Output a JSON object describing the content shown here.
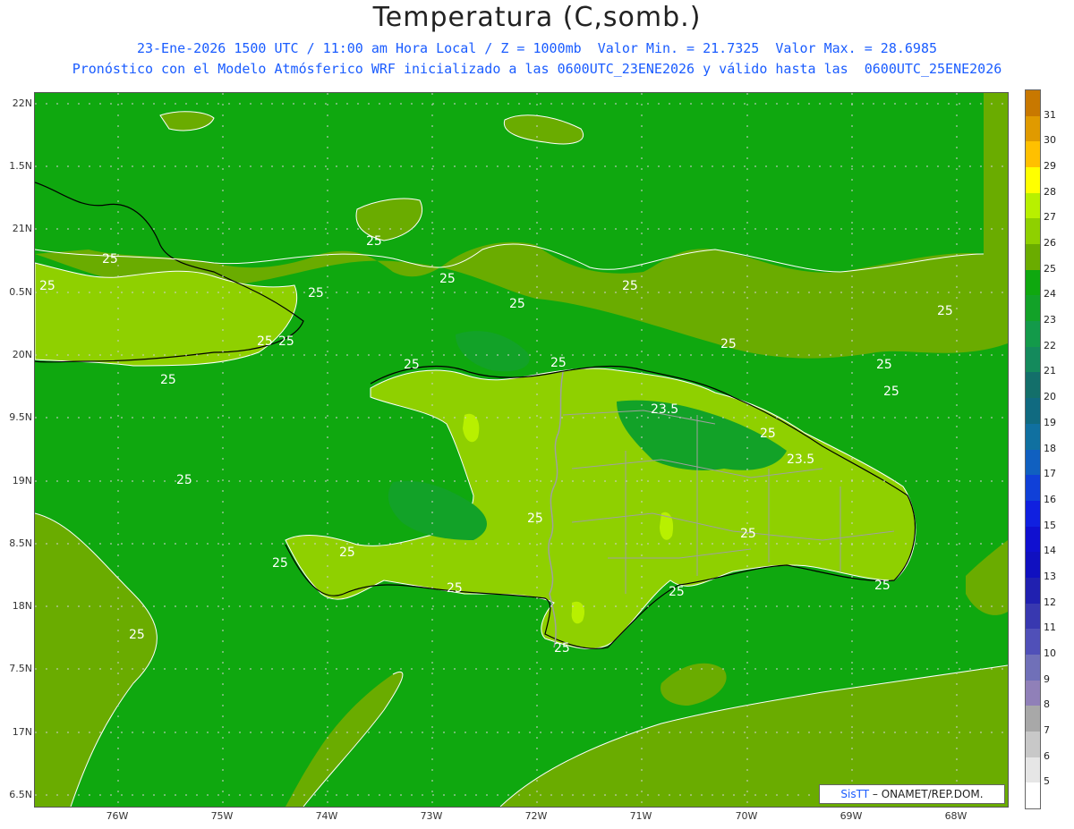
{
  "header": {
    "title": "Temperatura (C,somb.)",
    "subtitle1": "23-Ene-2026 1500 UTC / 11:00 am Hora Local / Z = 1000mb  Valor Min. = 21.7325  Valor Max. = 28.6985",
    "subtitle2": "Pronóstico con el Modelo Atmósferico WRF inicializado a las 0600UTC_23ENE2026 y válido hasta las  0600UTC_25ENE2026"
  },
  "axes": {
    "lat_labels": [
      "22N",
      "1.5N",
      "21N",
      "0.5N",
      "20N",
      "9.5N",
      "19N",
      "8.5N",
      "18N",
      "7.5N",
      "17N",
      "6.5N"
    ],
    "lon_labels": [
      "76W",
      "75W",
      "74W",
      "73W",
      "72W",
      "71W",
      "70W",
      "69W",
      "68W"
    ]
  },
  "colorbar": {
    "labels": [
      "31",
      "30",
      "29",
      "28",
      "27",
      "26",
      "25",
      "24",
      "23",
      "22",
      "21",
      "20",
      "19",
      "18",
      "17",
      "16",
      "15",
      "14",
      "13",
      "12",
      "11",
      "10",
      "9",
      "8",
      "7",
      "6",
      "5"
    ],
    "colors": [
      "#c87800",
      "#e09a00",
      "#ffc000",
      "#ffff00",
      "#b8f000",
      "#8fd000",
      "#6aac00",
      "#0fa80f",
      "#12a228",
      "#139a4a",
      "#148a5c",
      "#136f6a",
      "#106a80",
      "#1070a0",
      "#1060c0",
      "#1040d8",
      "#1020e0",
      "#1010d0",
      "#1010c0",
      "#2020b0",
      "#3838b0",
      "#5050b8",
      "#7070b8",
      "#9080b8",
      "#a8a8a8",
      "#c8c8c8",
      "#e6e6e6",
      "#ffffff"
    ]
  },
  "contour_labels": [
    "25",
    "25",
    "25",
    "25",
    "25",
    "25",
    "25",
    "25",
    "25",
    "25",
    "25",
    "25",
    "25",
    "25",
    "25",
    "25",
    "25",
    "25",
    "25",
    "25",
    "25",
    "25",
    "25",
    "25",
    "25",
    "25",
    "25",
    "23.5",
    "23.5"
  ],
  "credit": {
    "brand": "SisTT",
    "text": " – ONAMET/REP.DOM."
  }
}
